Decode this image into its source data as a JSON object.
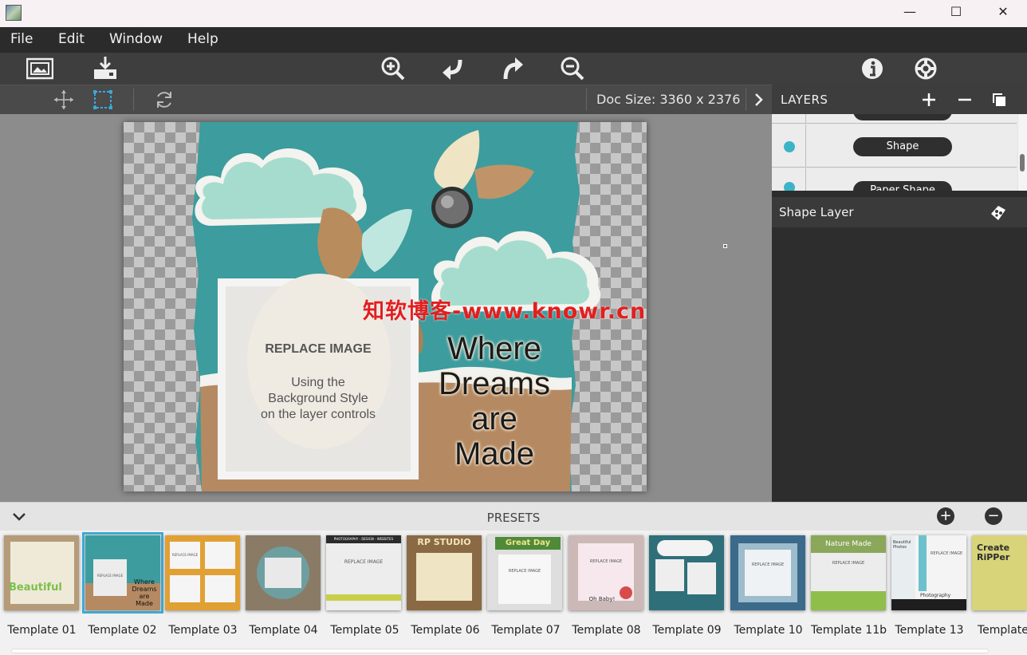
{
  "titlebar": {
    "minimize": "—",
    "maximize": "☐",
    "close": "✕"
  },
  "menu": [
    "File",
    "Edit",
    "Window",
    "Help"
  ],
  "subtoolbar": {
    "doc_size": "Doc Size: 3360 x 2376"
  },
  "canvas": {
    "replace_title": "REPLACE IMAGE",
    "replace_l1": "Using the",
    "replace_l2": "Background Style",
    "replace_l3": "on the layer controls",
    "word1": "Where",
    "word2": "Dreams",
    "word3": "are",
    "word4": "Made"
  },
  "watermark": "知软博客-www.knowr.cn",
  "layers": {
    "title": "LAYERS",
    "row_label": "Shape",
    "row_partial": "Paper Shape",
    "selected": "Shape Layer"
  },
  "presets": {
    "title": "PRESETS",
    "templates": [
      "Template 01",
      "Template 02",
      "Template 03",
      "Template 04",
      "Template 05",
      "Template 06",
      "Template 07",
      "Template 08",
      "Template 09",
      "Template 10",
      "Template 11b",
      "Template 13",
      "Template"
    ],
    "thumb_texts": {
      "t01": "Beautiful",
      "t02a": "REPLACE IMAGE",
      "t02b": "Where Dreams are Made",
      "t03": "REPLACE IMAGE",
      "t05a": "PHOTOGRAPHY - DESIGN - WEBSITES",
      "t05b": "REPLACE IMAGE",
      "t06": "RP STUDIO",
      "t07a": "Great Day",
      "t07b": "REPLACE IMAGE",
      "t08a": "REPLACE IMAGE",
      "t08b": "Oh Baby!",
      "t10": "REPLACE IMAGE",
      "t11a": "Nature Made",
      "t11b": "REPLACE IMAGE",
      "t13a": "Beautiful Photos",
      "t13b": "REPLACE IMAGE",
      "t13c": "Photography",
      "t14": "Create RiPPer"
    }
  }
}
